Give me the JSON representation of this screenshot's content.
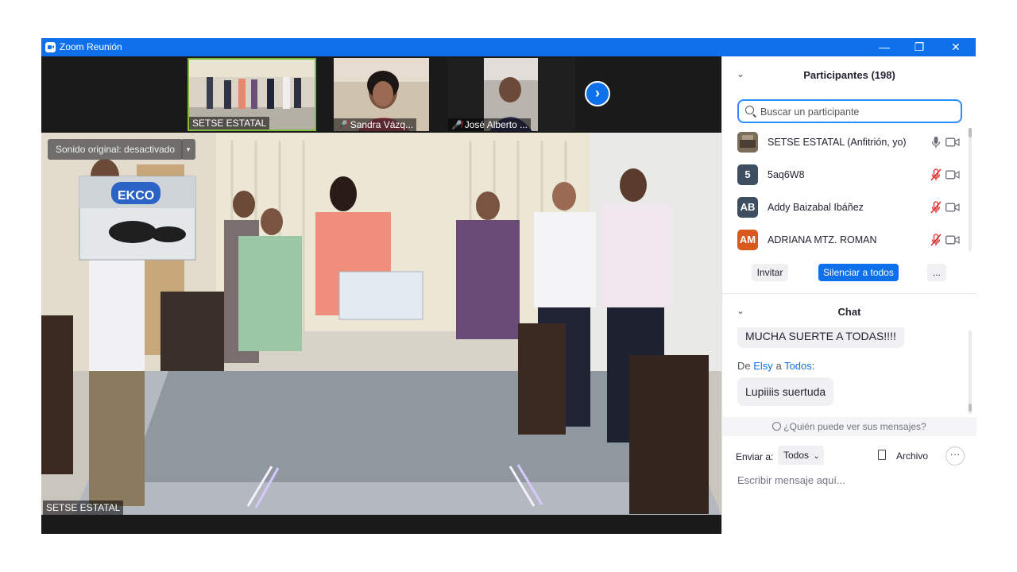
{
  "window": {
    "title": "Zoom Reunión",
    "controls": [
      "—",
      "❐",
      "✕"
    ]
  },
  "thumbnails": [
    {
      "name": "SETSE ESTATAL",
      "muted": false
    },
    {
      "name": "Sandra Vázq...",
      "muted": true
    },
    {
      "name": "José Alberto ...",
      "muted": true
    }
  ],
  "next_arrow": "›",
  "main_video": {
    "sound_button": "Sonido original: desactivado",
    "sound_dropdown": "▾",
    "speaker_name": "SETSE ESTATAL",
    "box_brand": "EKCO"
  },
  "participants": {
    "title": "Participantes (198)",
    "search_placeholder": "Buscar un participante",
    "list": [
      {
        "initials": "",
        "name": "SETSE ESTATAL (Anfitrión, yo)",
        "avatar_color": "#7a6e5a",
        "mic": "on",
        "icon_name": "photo-avatar"
      },
      {
        "initials": "5",
        "name": "5aq6W8",
        "avatar_color": "#3d4e61",
        "mic": "muted"
      },
      {
        "initials": "AB",
        "name": "Addy Baizabal Ibáñez",
        "avatar_color": "#3d4e61",
        "mic": "muted"
      },
      {
        "initials": "AM",
        "name": "ADRIANA MTZ. ROMAN",
        "avatar_color": "#d8581e",
        "mic": "muted"
      }
    ],
    "invite": "Invitar",
    "mute_all": "Silenciar a todos",
    "more": "..."
  },
  "chat": {
    "title": "Chat",
    "message1": "MUCHA SUERTE A TODAS!!!!",
    "meta_from": "De",
    "meta_sender": "Elsy",
    "meta_a": "a",
    "meta_to": "Todos",
    "meta_colon": ":",
    "message2": "Lupiiiis suertuda",
    "who_can_see": "¿Quién puede ver sus mensajes?",
    "send_to_label": "Enviar a:",
    "send_to_value": "Todos",
    "file_label": "Archivo",
    "more": "···",
    "input_placeholder": "Escribir mensaje aquí..."
  },
  "colors": {
    "accent": "#0e71eb",
    "muted_red": "#e02828",
    "mute_all_button": "#0e71eb"
  }
}
